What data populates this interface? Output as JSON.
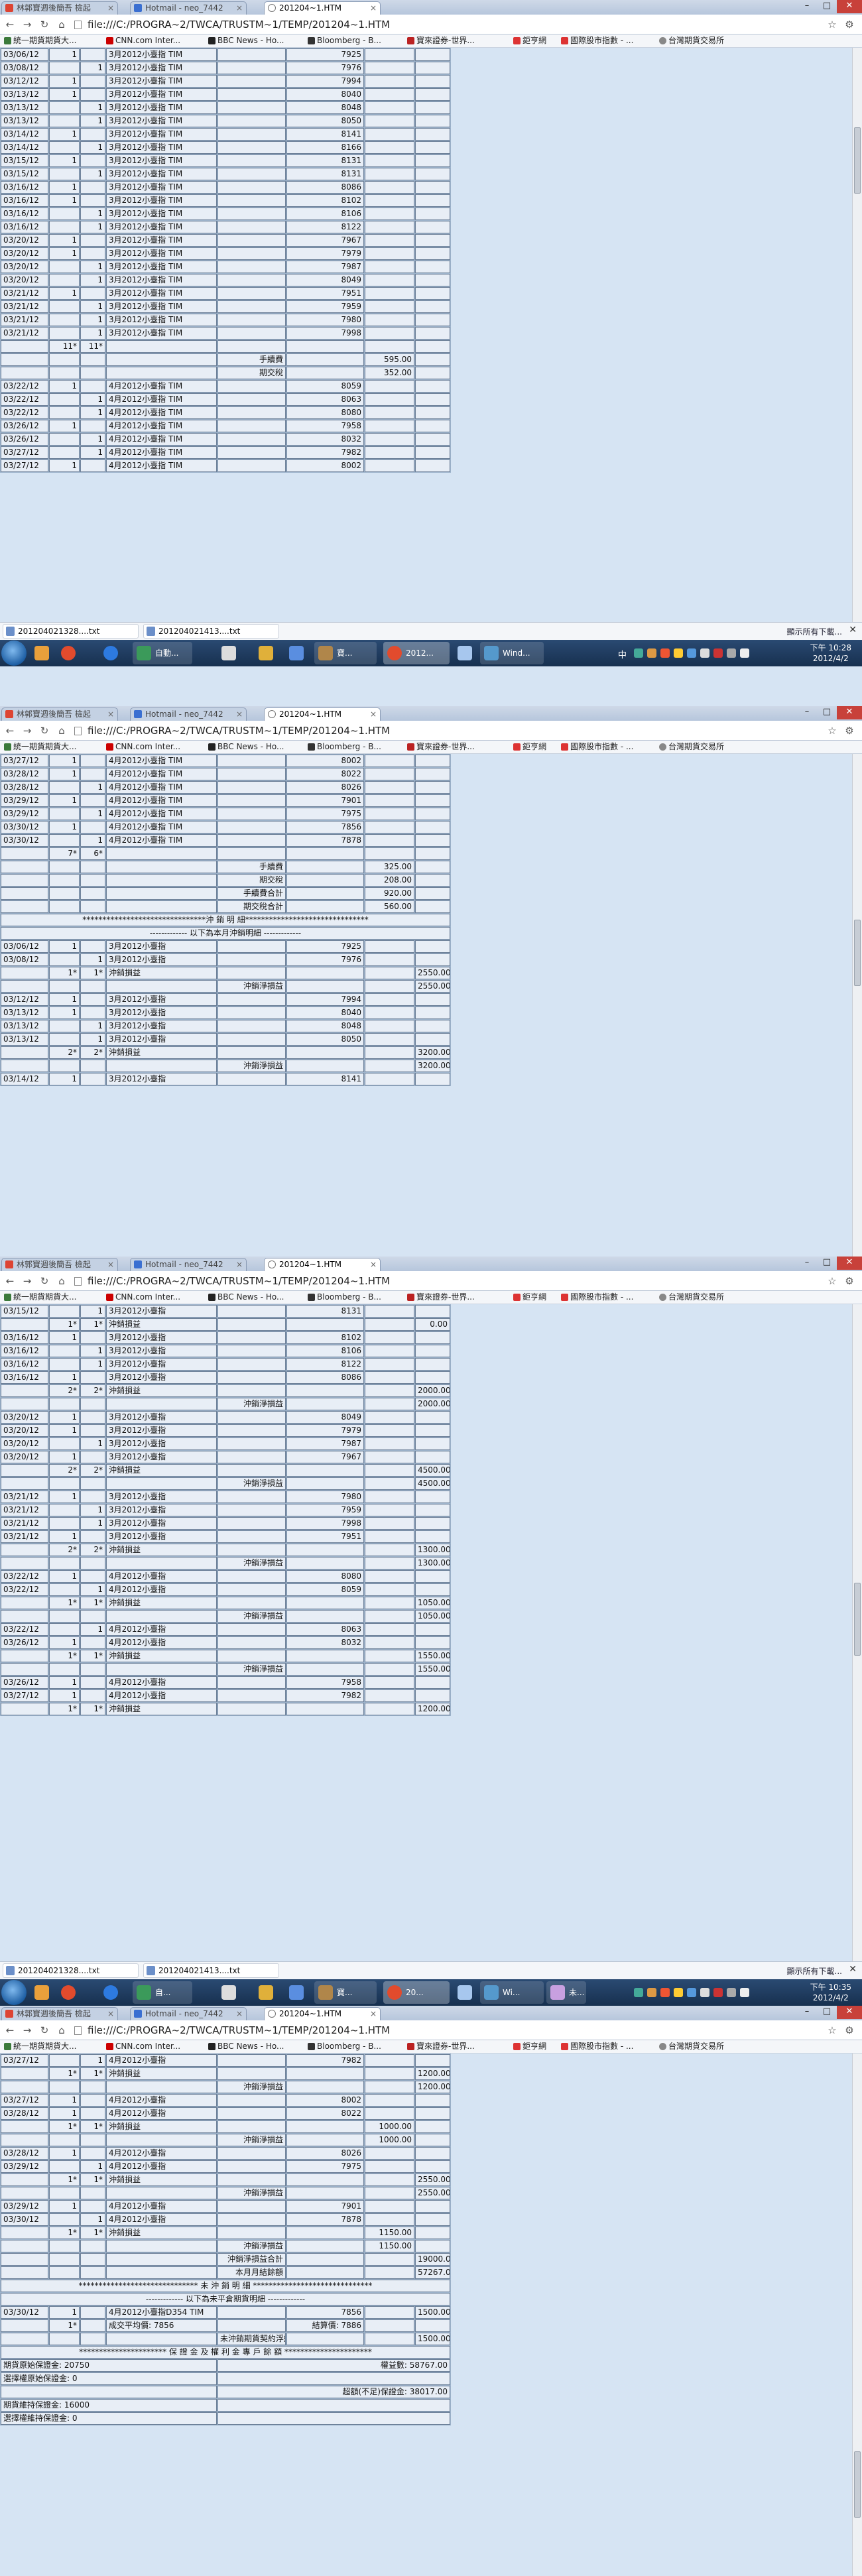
{
  "browser": {
    "tabs": [
      "林郭寶週後簡吾 檢起",
      "Hotmail - neo_7442",
      "201204~1.HTM"
    ],
    "url": "file:///C:/PROGRA~2/TWCA/TRUSTM~1/TEMP/201204~1.HTM",
    "bookmarks": [
      "統一期貨期貨大...",
      "CNN.com Inter...",
      "BBC News - Ho...",
      "Bloomberg - B...",
      "寶來證券-世界...",
      "鉅亨網",
      "國際股市指數 - ...",
      "台灣期貨交易所"
    ]
  },
  "downloads": {
    "items": [
      "201204021328....txt",
      "201204021413....txt"
    ],
    "show_all": "顯示所有下載...",
    "close": "✕"
  },
  "taskbar": {
    "s1": {
      "items": [
        "",
        "",
        "",
        "自動...",
        "",
        "",
        "",
        "寶...",
        "2012...",
        "",
        "Wind...",
        "中"
      ],
      "time": "下午 10:28",
      "date": "2012/4/2"
    },
    "s2": {
      "items": [
        "",
        "",
        "",
        "自...",
        "",
        "",
        "",
        "寶...",
        "20...",
        "",
        "Wi...",
        "未..."
      ],
      "time": "下午 10:35",
      "date": "2012/4/2"
    }
  },
  "rows": {
    "s1": [
      [
        "03/06/12",
        "1",
        "",
        "3月2012小臺指 TIM",
        "",
        "7925",
        "",
        ""
      ],
      [
        "03/08/12",
        "",
        "1",
        "3月2012小臺指 TIM",
        "",
        "7976",
        "",
        ""
      ],
      [
        "03/12/12",
        "1",
        "",
        "3月2012小臺指 TIM",
        "",
        "7994",
        "",
        ""
      ],
      [
        "03/13/12",
        "1",
        "",
        "3月2012小臺指 TIM",
        "",
        "8040",
        "",
        ""
      ],
      [
        "03/13/12",
        "",
        "1",
        "3月2012小臺指 TIM",
        "",
        "8048",
        "",
        ""
      ],
      [
        "03/13/12",
        "",
        "1",
        "3月2012小臺指 TIM",
        "",
        "8050",
        "",
        ""
      ],
      [
        "03/14/12",
        "1",
        "",
        "3月2012小臺指 TIM",
        "",
        "8141",
        "",
        ""
      ],
      [
        "03/14/12",
        "",
        "1",
        "3月2012小臺指 TIM",
        "",
        "8166",
        "",
        ""
      ],
      [
        "03/15/12",
        "1",
        "",
        "3月2012小臺指 TIM",
        "",
        "8131",
        "",
        ""
      ],
      [
        "03/15/12",
        "",
        "1",
        "3月2012小臺指 TIM",
        "",
        "8131",
        "",
        ""
      ],
      [
        "03/16/12",
        "1",
        "",
        "3月2012小臺指 TIM",
        "",
        "8086",
        "",
        ""
      ],
      [
        "03/16/12",
        "1",
        "",
        "3月2012小臺指 TIM",
        "",
        "8102",
        "",
        ""
      ],
      [
        "03/16/12",
        "",
        "1",
        "3月2012小臺指 TIM",
        "",
        "8106",
        "",
        ""
      ],
      [
        "03/16/12",
        "",
        "1",
        "3月2012小臺指 TIM",
        "",
        "8122",
        "",
        ""
      ],
      [
        "03/20/12",
        "1",
        "",
        "3月2012小臺指 TIM",
        "",
        "7967",
        "",
        ""
      ],
      [
        "03/20/12",
        "1",
        "",
        "3月2012小臺指 TIM",
        "",
        "7979",
        "",
        ""
      ],
      [
        "03/20/12",
        "",
        "1",
        "3月2012小臺指 TIM",
        "",
        "7987",
        "",
        ""
      ],
      [
        "03/20/12",
        "",
        "1",
        "3月2012小臺指 TIM",
        "",
        "8049",
        "",
        ""
      ],
      [
        "03/21/12",
        "1",
        "",
        "3月2012小臺指 TIM",
        "",
        "7951",
        "",
        ""
      ],
      [
        "03/21/12",
        "",
        "1",
        "3月2012小臺指 TIM",
        "",
        "7959",
        "",
        ""
      ],
      [
        "03/21/12",
        "",
        "1",
        "3月2012小臺指 TIM",
        "",
        "7980",
        "",
        ""
      ],
      [
        "03/21/12",
        "",
        "1",
        "3月2012小臺指 TIM",
        "",
        "7998",
        "",
        ""
      ],
      [
        "",
        "11*",
        "11*",
        "",
        "",
        "",
        "",
        ""
      ],
      [
        "",
        "",
        "",
        "",
        "手續費",
        "",
        "595.00",
        ""
      ],
      [
        "",
        "",
        "",
        "",
        "期交稅",
        "",
        "352.00",
        ""
      ],
      [
        "03/22/12",
        "1",
        "",
        "4月2012小臺指 TIM",
        "",
        "8059",
        "",
        ""
      ],
      [
        "03/22/12",
        "",
        "1",
        "4月2012小臺指 TIM",
        "",
        "8063",
        "",
        ""
      ],
      [
        "03/22/12",
        "",
        "1",
        "4月2012小臺指 TIM",
        "",
        "8080",
        "",
        ""
      ],
      [
        "03/26/12",
        "1",
        "",
        "4月2012小臺指 TIM",
        "",
        "7958",
        "",
        ""
      ],
      [
        "03/26/12",
        "",
        "1",
        "4月2012小臺指 TIM",
        "",
        "8032",
        "",
        ""
      ],
      [
        "03/27/12",
        "",
        "1",
        "4月2012小臺指 TIM",
        "",
        "7982",
        "",
        ""
      ],
      [
        "03/27/12",
        "1",
        "",
        "4月2012小臺指 TIM",
        "",
        "8002",
        "",
        ""
      ]
    ],
    "s2": [
      [
        "03/27/12",
        "1",
        "",
        "4月2012小臺指 TIM",
        "",
        "8002",
        "",
        ""
      ],
      [
        "03/28/12",
        "1",
        "",
        "4月2012小臺指 TIM",
        "",
        "8022",
        "",
        ""
      ],
      [
        "03/28/12",
        "",
        "1",
        "4月2012小臺指 TIM",
        "",
        "8026",
        "",
        ""
      ],
      [
        "03/29/12",
        "1",
        "",
        "4月2012小臺指 TIM",
        "",
        "7901",
        "",
        ""
      ],
      [
        "03/29/12",
        "",
        "1",
        "4月2012小臺指 TIM",
        "",
        "7975",
        "",
        ""
      ],
      [
        "03/30/12",
        "1",
        "",
        "4月2012小臺指 TIM",
        "",
        "7856",
        "",
        ""
      ],
      [
        "03/30/12",
        "",
        "1",
        "4月2012小臺指 TIM",
        "",
        "7878",
        "",
        ""
      ],
      [
        "",
        "7*",
        "6*",
        "",
        "",
        "",
        "",
        ""
      ],
      [
        "",
        "",
        "",
        "",
        "手續費",
        "",
        "325.00",
        ""
      ],
      [
        "",
        "",
        "",
        "",
        "期交稅",
        "",
        "208.00",
        ""
      ],
      [
        "",
        "",
        "",
        "",
        "手續費合計",
        "",
        "920.00",
        ""
      ],
      [
        "",
        "",
        "",
        "",
        "期交稅合計",
        "",
        "560.00",
        ""
      ],
      [
        "@*******************************沖 銷 明 細*******************************"
      ],
      [
        "@------------- 以下為本月沖銷明細 -------------"
      ],
      [
        "03/06/12",
        "1",
        "",
        "3月2012小臺指",
        "",
        "7925",
        "",
        ""
      ],
      [
        "03/08/12",
        "",
        "1",
        "3月2012小臺指",
        "",
        "7976",
        "",
        ""
      ],
      [
        "",
        "1*",
        "1*",
        "沖銷損益",
        "",
        "",
        "",
        "2550.00"
      ],
      [
        "",
        "",
        "",
        "",
        "沖銷淨損益",
        "",
        "",
        "2550.00"
      ],
      [
        "03/12/12",
        "1",
        "",
        "3月2012小臺指",
        "",
        "7994",
        "",
        ""
      ],
      [
        "03/13/12",
        "1",
        "",
        "3月2012小臺指",
        "",
        "8040",
        "",
        ""
      ],
      [
        "03/13/12",
        "",
        "1",
        "3月2012小臺指",
        "",
        "8048",
        "",
        ""
      ],
      [
        "03/13/12",
        "",
        "1",
        "3月2012小臺指",
        "",
        "8050",
        "",
        ""
      ],
      [
        "",
        "2*",
        "2*",
        "沖銷損益",
        "",
        "",
        "",
        "3200.00"
      ],
      [
        "",
        "",
        "",
        "",
        "沖銷淨損益",
        "",
        "",
        "3200.00"
      ],
      [
        "03/14/12",
        "1",
        "",
        "3月2012小臺指",
        "",
        "8141",
        "",
        ""
      ]
    ],
    "s3": [
      [
        "03/15/12",
        "",
        "1",
        "3月2012小臺指",
        "",
        "8131",
        "",
        ""
      ],
      [
        "",
        "1*",
        "1*",
        "沖銷損益",
        "",
        "",
        "",
        "0.00"
      ],
      [
        "03/16/12",
        "1",
        "",
        "3月2012小臺指",
        "",
        "8102",
        "",
        ""
      ],
      [
        "03/16/12",
        "",
        "1",
        "3月2012小臺指",
        "",
        "8106",
        "",
        ""
      ],
      [
        "03/16/12",
        "",
        "1",
        "3月2012小臺指",
        "",
        "8122",
        "",
        ""
      ],
      [
        "03/16/12",
        "1",
        "",
        "3月2012小臺指",
        "",
        "8086",
        "",
        ""
      ],
      [
        "",
        "2*",
        "2*",
        "沖銷損益",
        "",
        "",
        "",
        "2000.00"
      ],
      [
        "",
        "",
        "",
        "",
        "沖銷淨損益",
        "",
        "",
        "2000.00"
      ],
      [
        "03/20/12",
        "1",
        "",
        "3月2012小臺指",
        "",
        "8049",
        "",
        ""
      ],
      [
        "03/20/12",
        "1",
        "",
        "3月2012小臺指",
        "",
        "7979",
        "",
        ""
      ],
      [
        "03/20/12",
        "",
        "1",
        "3月2012小臺指",
        "",
        "7987",
        "",
        ""
      ],
      [
        "03/20/12",
        "1",
        "",
        "3月2012小臺指",
        "",
        "7967",
        "",
        ""
      ],
      [
        "",
        "2*",
        "2*",
        "沖銷損益",
        "",
        "",
        "",
        "4500.00"
      ],
      [
        "",
        "",
        "",
        "",
        "沖銷淨損益",
        "",
        "",
        "4500.00"
      ],
      [
        "03/21/12",
        "1",
        "",
        "3月2012小臺指",
        "",
        "7980",
        "",
        ""
      ],
      [
        "03/21/12",
        "",
        "1",
        "3月2012小臺指",
        "",
        "7959",
        "",
        ""
      ],
      [
        "03/21/12",
        "",
        "1",
        "3月2012小臺指",
        "",
        "7998",
        "",
        ""
      ],
      [
        "03/21/12",
        "1",
        "",
        "3月2012小臺指",
        "",
        "7951",
        "",
        ""
      ],
      [
        "",
        "2*",
        "2*",
        "沖銷損益",
        "",
        "",
        "",
        "1300.00"
      ],
      [
        "",
        "",
        "",
        "",
        "沖銷淨損益",
        "",
        "",
        "1300.00"
      ],
      [
        "03/22/12",
        "1",
        "",
        "4月2012小臺指",
        "",
        "8080",
        "",
        ""
      ],
      [
        "03/22/12",
        "",
        "1",
        "4月2012小臺指",
        "",
        "8059",
        "",
        ""
      ],
      [
        "",
        "1*",
        "1*",
        "沖銷損益",
        "",
        "",
        "",
        "1050.00"
      ],
      [
        "",
        "",
        "",
        "",
        "沖銷淨損益",
        "",
        "",
        "1050.00"
      ],
      [
        "03/22/12",
        "",
        "1",
        "4月2012小臺指",
        "",
        "8063",
        "",
        ""
      ],
      [
        "03/26/12",
        "1",
        "",
        "4月2012小臺指",
        "",
        "8032",
        "",
        ""
      ],
      [
        "",
        "1*",
        "1*",
        "沖銷損益",
        "",
        "",
        "",
        "1550.00"
      ],
      [
        "",
        "",
        "",
        "",
        "沖銷淨損益",
        "",
        "",
        "1550.00"
      ],
      [
        "03/26/12",
        "1",
        "",
        "4月2012小臺指",
        "",
        "7958",
        "",
        ""
      ],
      [
        "03/27/12",
        "1",
        "",
        "4月2012小臺指",
        "",
        "7982",
        "",
        ""
      ],
      [
        "",
        "1*",
        "1*",
        "沖銷損益",
        "",
        "",
        "",
        "1200.00"
      ]
    ],
    "s4": [
      [
        "03/27/12",
        "",
        "1",
        "4月2012小臺指",
        "",
        "7982",
        "",
        ""
      ],
      [
        "",
        "1*",
        "1*",
        "沖銷損益",
        "",
        "",
        "",
        "1200.00"
      ],
      [
        "",
        "",
        "",
        "",
        "沖銷淨損益",
        "",
        "",
        "1200.00"
      ],
      [
        "03/27/12",
        "1",
        "",
        "4月2012小臺指",
        "",
        "8002",
        "",
        ""
      ],
      [
        "03/28/12",
        "1",
        "",
        "4月2012小臺指",
        "",
        "8022",
        "",
        ""
      ],
      [
        "",
        "1*",
        "1*",
        "沖銷損益",
        "",
        "",
        "1000.00",
        ""
      ],
      [
        "",
        "",
        "",
        "",
        "沖銷淨損益",
        "",
        "1000.00",
        ""
      ],
      [
        "03/28/12",
        "1",
        "",
        "4月2012小臺指",
        "",
        "8026",
        "",
        ""
      ],
      [
        "03/29/12",
        "",
        "1",
        "4月2012小臺指",
        "",
        "7975",
        "",
        ""
      ],
      [
        "",
        "1*",
        "1*",
        "沖銷損益",
        "",
        "",
        "",
        "2550.00"
      ],
      [
        "",
        "",
        "",
        "",
        "沖銷淨損益",
        "",
        "",
        "2550.00"
      ],
      [
        "03/29/12",
        "1",
        "",
        "4月2012小臺指",
        "",
        "7901",
        "",
        ""
      ],
      [
        "03/30/12",
        "",
        "1",
        "4月2012小臺指",
        "",
        "7878",
        "",
        ""
      ],
      [
        "",
        "1*",
        "1*",
        "沖銷損益",
        "",
        "",
        "1150.00",
        ""
      ],
      [
        "",
        "",
        "",
        "",
        "沖銷淨損益",
        "",
        "1150.00",
        ""
      ],
      [
        "",
        "",
        "",
        "",
        "沖銷淨損益合計",
        "",
        "",
        "19000.00"
      ],
      [
        "",
        "",
        "",
        "",
        "本月月結餘額",
        "",
        "",
        "57267.00"
      ],
      [
        "@****************************** 未 沖 銷 明 細 ******************************"
      ],
      [
        "@------------- 以下為未平倉期貨明細 -------------"
      ],
      [
        "03/30/12",
        "1",
        "",
        "4月2012小臺指D354 TIM",
        "",
        "7856",
        "",
        "1500.00"
      ],
      [
        "",
        "1*",
        "",
        "成交平均價: 7856",
        "",
        "結算價: 7886",
        "",
        ""
      ],
      [
        "",
        "",
        "",
        "",
        "未沖銷期貨契約浮動損益:",
        "",
        "",
        "1500.00"
      ],
      [
        "@********************** 保 證 金 及 權 利 金 專 戶 餘 額 **********************"
      ],
      [
        "#期貨原始保證金: 20750",
        "",
        "權益數: 58767.00"
      ],
      [
        "#選擇權原始保證金: 0",
        "",
        ""
      ],
      [
        "#",
        "",
        "超額(不足)保證金: 38017.00"
      ],
      [
        "#期貨維持保證金: 16000",
        "",
        ""
      ],
      [
        "#選擇權維持保證金: 0",
        "",
        ""
      ]
    ]
  }
}
